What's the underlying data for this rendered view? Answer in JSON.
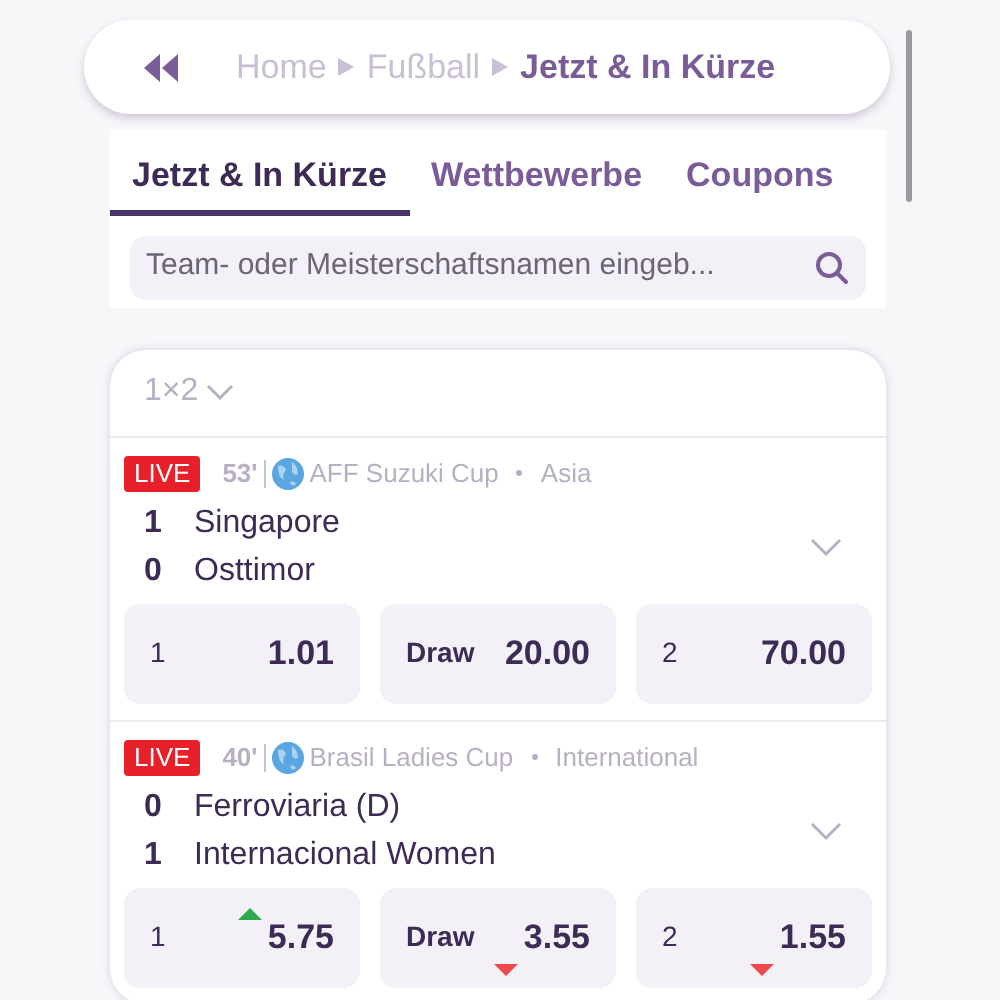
{
  "breadcrumb": {
    "items": [
      {
        "label": "Home",
        "current": false
      },
      {
        "label": "Fußball",
        "current": false
      },
      {
        "label": "Jetzt & In Kürze",
        "current": true
      }
    ]
  },
  "tabs": [
    {
      "label": "Jetzt & In Kürze",
      "selected": true
    },
    {
      "label": "Wettbewerbe",
      "selected": false
    },
    {
      "label": "Coupons",
      "selected": false
    }
  ],
  "search": {
    "placeholder": "Team- oder Meisterschaftsnamen eingeb..."
  },
  "market": {
    "label": "1×2"
  },
  "matches": [
    {
      "live": "LIVE",
      "minute": "53'",
      "competition": "AFF Suzuki Cup",
      "region": "Asia",
      "teams": [
        {
          "score": "1",
          "name": "Singapore"
        },
        {
          "score": "0",
          "name": "Osttimor"
        }
      ],
      "odds": [
        {
          "label": "1",
          "price": "1.01",
          "up": false,
          "down": false
        },
        {
          "label": "Draw",
          "price": "20.00",
          "up": false,
          "down": false
        },
        {
          "label": "2",
          "price": "70.00",
          "up": false,
          "down": false
        }
      ]
    },
    {
      "live": "LIVE",
      "minute": "40'",
      "competition": "Brasil Ladies Cup",
      "region": "International",
      "teams": [
        {
          "score": "0",
          "name": "Ferroviaria (D)"
        },
        {
          "score": "1",
          "name": "Internacional Women"
        }
      ],
      "odds": [
        {
          "label": "1",
          "price": "5.75",
          "up": true,
          "down": false
        },
        {
          "label": "Draw",
          "price": "3.55",
          "up": false,
          "down": true
        },
        {
          "label": "2",
          "price": "1.55",
          "up": false,
          "down": true
        }
      ]
    }
  ]
}
